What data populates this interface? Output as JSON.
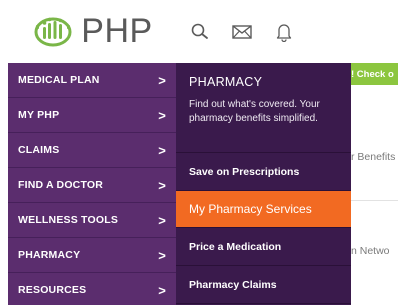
{
  "header": {
    "logo_text": "PHP",
    "logo_color": "#7ab648",
    "icons": [
      "search-icon",
      "mail-icon",
      "bell-icon"
    ]
  },
  "sidebar": {
    "bg_color": "#5b2d6e",
    "items": [
      {
        "label": "MEDICAL PLAN"
      },
      {
        "label": "MY PHP"
      },
      {
        "label": "CLAIMS"
      },
      {
        "label": "FIND A DOCTOR"
      },
      {
        "label": "WELLNESS TOOLS"
      },
      {
        "label": "PHARMACY"
      },
      {
        "label": "RESOURCES"
      }
    ],
    "chevron": ">"
  },
  "submenu": {
    "bg_color": "#3a1a4c",
    "active_color": "#f26a22",
    "title": "PHARMACY",
    "description": "Find out what's covered. Your pharmacy benefits simplified.",
    "items": [
      {
        "label": "Save on Prescriptions",
        "active": false
      },
      {
        "label": "My Pharmacy Services",
        "active": true
      },
      {
        "label": "Price a Medication",
        "active": false
      },
      {
        "label": "Pharmacy Claims",
        "active": false
      }
    ]
  },
  "background_page": {
    "banner_text": "! Check o",
    "banner_color": "#8cc63f",
    "partial_text_1": "r Benefits",
    "partial_text_2": "n Netwo"
  }
}
